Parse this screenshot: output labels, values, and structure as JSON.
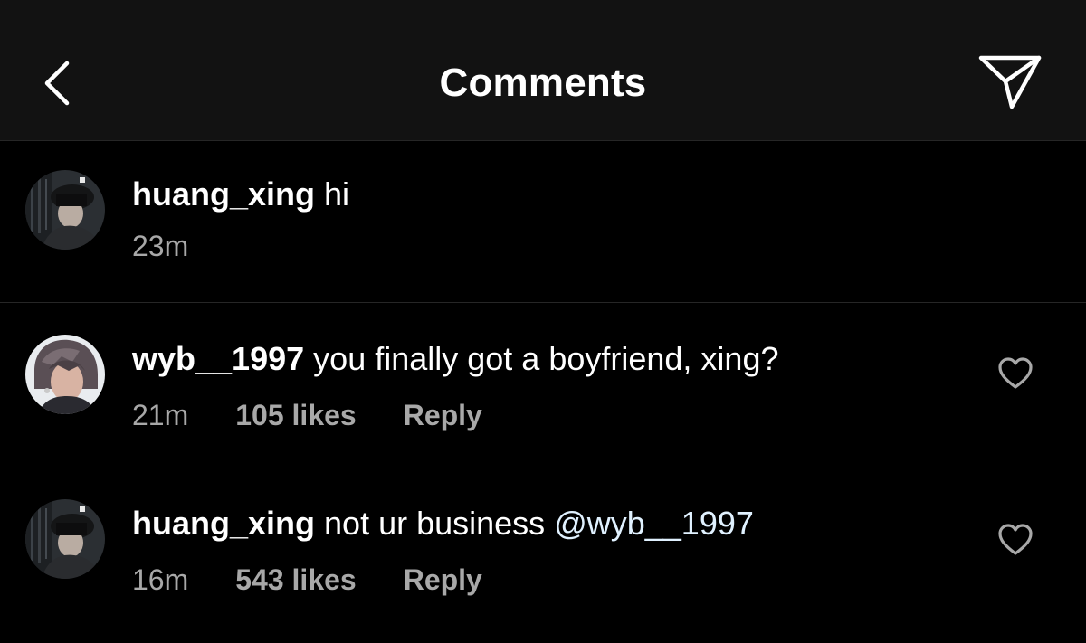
{
  "header": {
    "title": "Comments",
    "back_icon": "chevron-left-icon",
    "share_icon": "paper-plane-icon"
  },
  "comments": [
    {
      "username": "huang_xing",
      "text": "hi",
      "time": "23m",
      "likes": "",
      "reply": "",
      "avatar": "avatar-huang-xing"
    },
    {
      "username": "wyb__1997",
      "text": "you finally got a boyfriend, xing?",
      "time": "21m",
      "likes": "105 likes",
      "reply": "Reply",
      "avatar": "avatar-wyb"
    },
    {
      "username": "huang_xing",
      "text": "not ur business ",
      "mention": "@wyb__1997",
      "time": "16m",
      "likes": "543 likes",
      "reply": "Reply",
      "avatar": "avatar-huang-xing"
    }
  ],
  "colors": {
    "background": "#000000",
    "header_background": "#121212",
    "text": "#ffffff",
    "secondary_text": "#a8a8a8",
    "mention": "#e0f1ff"
  }
}
